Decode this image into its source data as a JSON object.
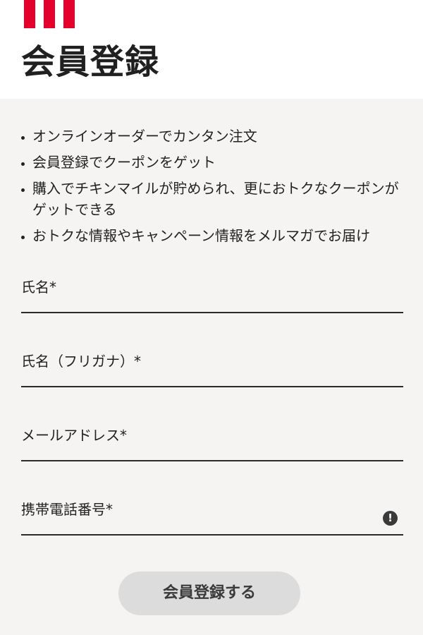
{
  "colors": {
    "brand_red": "#e4002b",
    "background": "#f5f4f3",
    "header_background": "#ffffff",
    "button_disabled": "#dcdcdc"
  },
  "header": {
    "title": "会員登録"
  },
  "benefits": [
    {
      "text": "オンラインオーダーでカンタン注文"
    },
    {
      "text": "会員登録でクーポンをゲット"
    },
    {
      "text": "購入でチキンマイルが貯められ、更におトクなクーポンがゲットできる"
    },
    {
      "text": "おトクな情報やキャンペーン情報をメルマガでお届け"
    }
  ],
  "form": {
    "name_label": "氏名*",
    "kana_label": "氏名（フリガナ）*",
    "email_label": "メールアドレス*",
    "phone_label": "携帯電話番号*",
    "phone_alert_icon": "exclamation-circle",
    "submit_label": "会員登録する"
  }
}
